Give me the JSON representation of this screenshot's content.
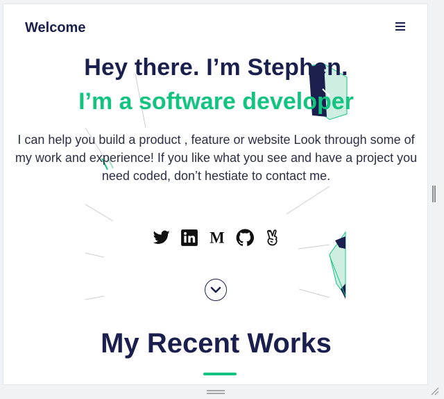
{
  "nav": {
    "brand": "Welcome",
    "menu_icon": "hamburger-menu-icon"
  },
  "hero": {
    "title": "Hey there. I’m Stephen.",
    "subtitle": "I’m a software developer",
    "description": "I can help you build a product , feature or website Look through some of my work and experience! If you like what you see and have a project you need coded, don’t hestiate to contact me.",
    "scroll_icon": "chevron-down-icon"
  },
  "socials": [
    {
      "name": "twitter",
      "icon": "twitter-icon"
    },
    {
      "name": "linkedin",
      "icon": "linkedin-icon"
    },
    {
      "name": "medium",
      "icon": "medium-icon"
    },
    {
      "name": "github",
      "icon": "github-icon"
    },
    {
      "name": "angellist",
      "icon": "angellist-icon"
    }
  ],
  "works": {
    "title": "My Recent Works"
  },
  "colors": {
    "primary": "#1a1f4d",
    "accent": "#12c480",
    "background": "#ffffff"
  }
}
